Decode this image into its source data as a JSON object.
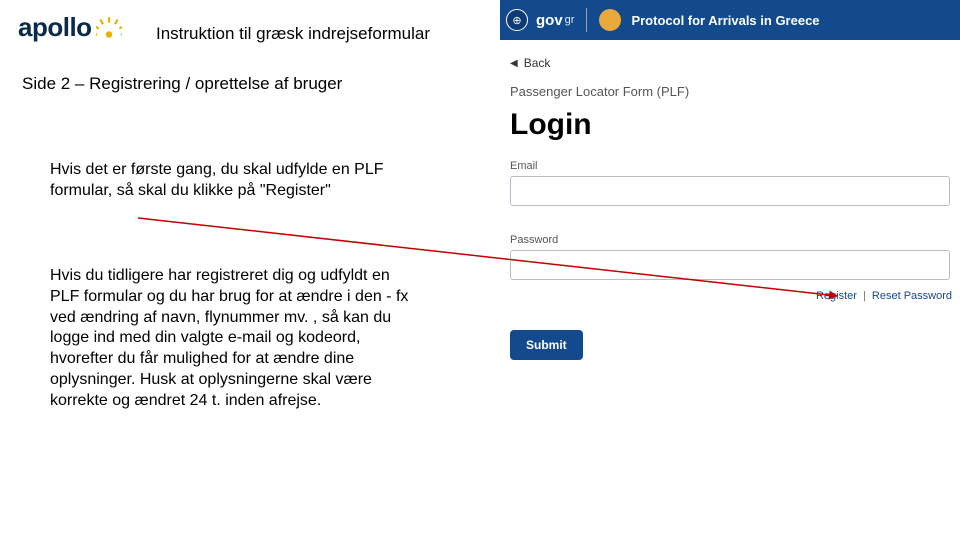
{
  "left": {
    "logo_text": "apollo",
    "instruction_title": "Instruktion til græsk indrejseformular",
    "page_title": "Side 2 – Registrering / oprettelse af bruger",
    "paragraph1": "Hvis det er første gang, du skal udfylde en PLF formular, så skal du klikke på \"Register\"",
    "paragraph2": "Hvis du tidligere har registreret dig og udfyldt en PLF formular og du har brug for at ændre i den - fx ved ændring af navn, flynummer mv. , så kan du logge ind med din valgte e-mail og kodeord, hvorefter du får mulighed for at ændre dine oplysninger. Husk at oplysningerne skal være korrekte og ændret 24 t. inden afrejse."
  },
  "right": {
    "banner": {
      "gov_label": "gov",
      "gov_suffix": "gr",
      "tagline": "Protocol for Arrivals in Greece"
    },
    "back_label": "Back",
    "form_title": "Passenger Locator Form (PLF)",
    "login_heading": "Login",
    "email_label": "Email",
    "password_label": "Password",
    "register_link": "Register",
    "link_separator": "|",
    "reset_link": "Reset Password",
    "submit_label": "Submit"
  }
}
